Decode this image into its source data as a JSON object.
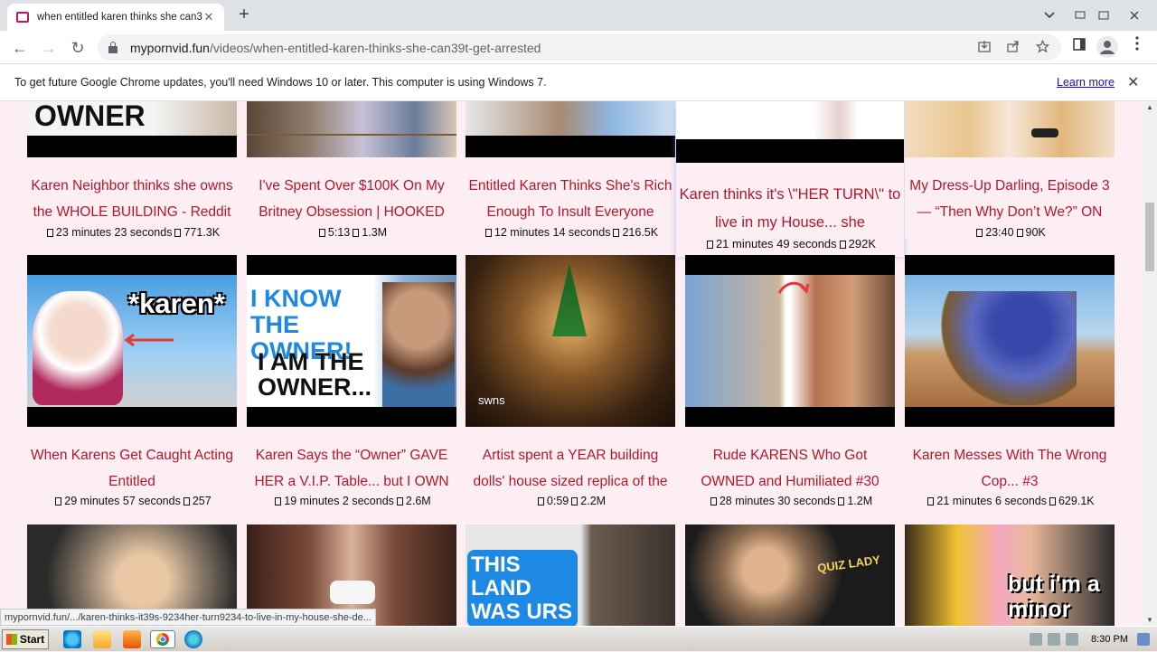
{
  "browser": {
    "tab_title": "when entitled karen thinks she can39",
    "tab_close": "✕",
    "new_tab": "+",
    "url_host": "mypornvid.fun",
    "url_path": "/videos/when-entitled-karen-thinks-she-can39t-get-arrested",
    "back": "←",
    "forward": "→",
    "reload": "↻"
  },
  "infobar": {
    "message": "To get future Google Chrome updates, you'll need Windows 10 or later. This computer is using Windows 7.",
    "learn_more": "Learn more",
    "close": "✕"
  },
  "videos_row1": [
    {
      "title": "Karen Neighbor thinks she owns the WHOLE BUILDING - Reddit",
      "duration": "23 minutes 23 seconds",
      "views": "771.3K",
      "overlay": "OWNER"
    },
    {
      "title": "I've Spent Over $100K On My Britney Obsession | HOOKED ON",
      "duration": "5:13",
      "views": "1.3M"
    },
    {
      "title": "Entitled Karen Thinks She's Rich Enough To Insult Everyone",
      "duration": "12 minutes 14 seconds",
      "views": "216.5K"
    },
    {
      "title": "Karen thinks it's \\\"HER TURN\\\" to live in my House... she",
      "duration": "21 minutes 49 seconds",
      "views": "292K"
    },
    {
      "title": "My Dress-Up Darling, Episode 3 — “Then Why Don’t We?” ON",
      "duration": "23:40",
      "views": "90K"
    }
  ],
  "videos_row2": [
    {
      "title": "When Karens Get Caught Acting Entitled",
      "duration": "29 minutes 57 seconds",
      "views": "257",
      "overlay": "*karen*"
    },
    {
      "title": "Karen Says the “Owner” GAVE HER a V.I.P. Table... but I OWN",
      "duration": "19 minutes 2 seconds",
      "views": "2.6M",
      "overlay1": "I KNOW THE OWNER!",
      "overlay2": "I AM THE OWNER..."
    },
    {
      "title": "Artist spent a YEAR building dolls' house sized replica of the",
      "duration": "0:59",
      "views": "2.2M",
      "overlay": "swns"
    },
    {
      "title": "Rude KARENS Who Got OWNED and Humiliated #30",
      "duration": "28 minutes 30 seconds",
      "views": "1.2M"
    },
    {
      "title": "Karen Messes With The Wrong Cop... #3",
      "duration": "21 minutes 6 seconds",
      "views": "629.1K"
    }
  ],
  "videos_row3": [
    {
      "overlay": ""
    },
    {
      "overlay": ""
    },
    {
      "overlay": "THIS LAND WAS URS"
    },
    {
      "overlay": "QUIZ LADY"
    },
    {
      "overlay": "but i'm a minor"
    }
  ],
  "status_url": "mypornvid.fun/.../karen-thinks-it39s-9234her-turn9234-to-live-in-my-house-she-de...",
  "taskbar": {
    "start": "Start",
    "clock": "8:30 PM"
  },
  "colors": {
    "title_red": "#b2182b",
    "page_bg": "#fdeef3"
  }
}
